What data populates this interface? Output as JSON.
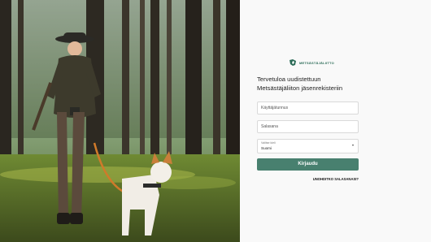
{
  "brand": {
    "name": "METSÄSTÄJÄLIITTO",
    "accent": "#2b6b57"
  },
  "welcome": {
    "line1": "Tervetuloa uudistettuun",
    "line2": "Metsästäjäliiton jäsenrekisteriin"
  },
  "form": {
    "username_placeholder": "Käyttäjätunnus",
    "password_placeholder": "Salasana",
    "language_label": "Valitse kieli",
    "language_value": "Suomi",
    "login_label": "Kirjaudu",
    "forgot_label": "UNOHDITKO SALASANASI?",
    "button_color": "#48806f"
  },
  "icons": {
    "logo": "dog-head-logo-icon",
    "select_caret": "chevron-down-icon"
  }
}
